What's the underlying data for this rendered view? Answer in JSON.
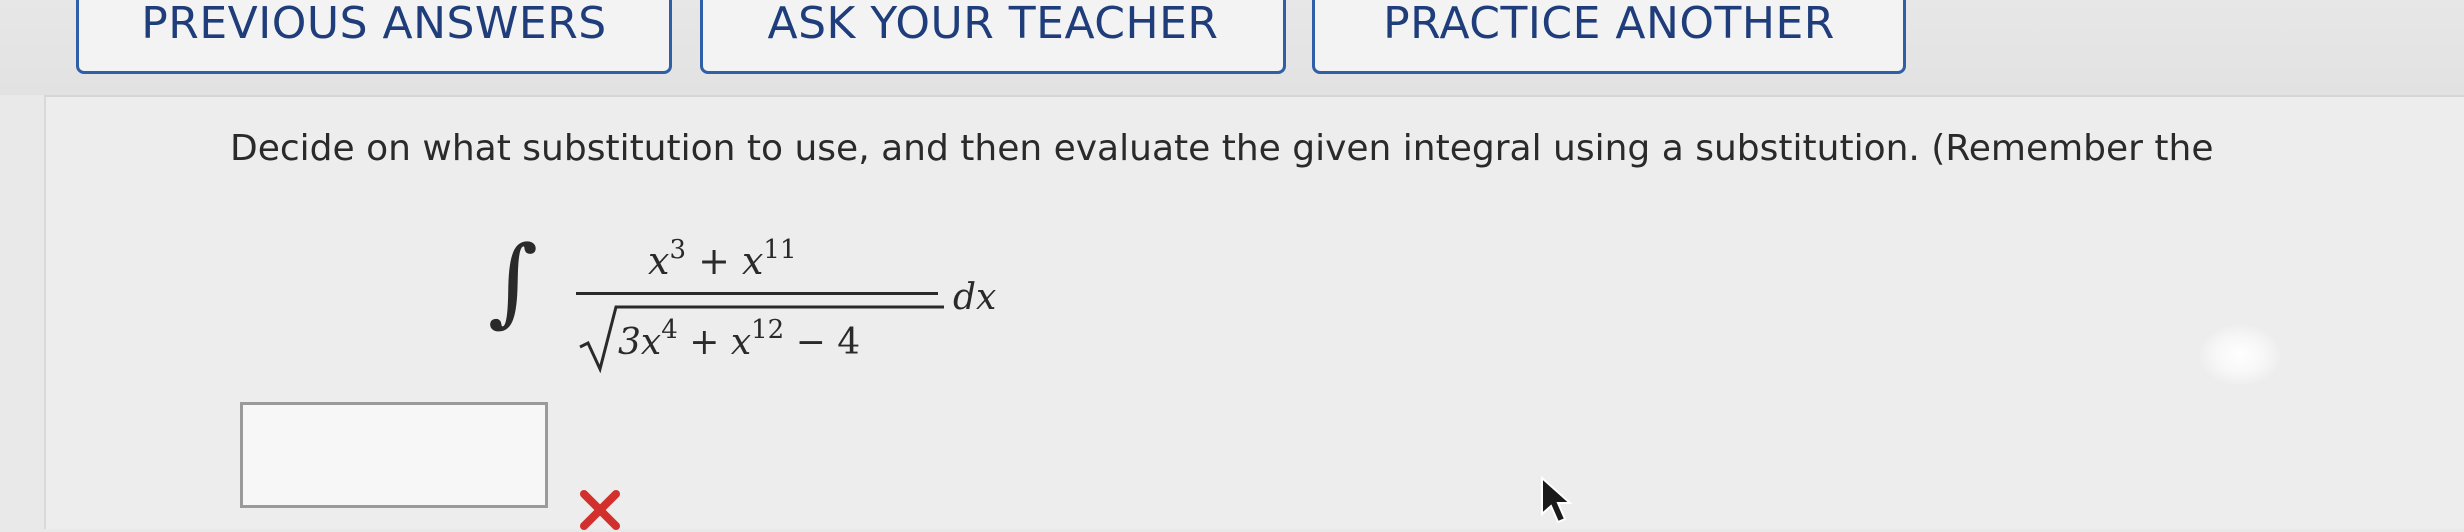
{
  "toolbar": {
    "previous_answers_label": "PREVIOUS ANSWERS",
    "ask_teacher_label": "ASK YOUR TEACHER",
    "practice_another_label": "PRACTICE ANOTHER"
  },
  "question": {
    "prompt": "Decide on what substitution to use, and then evaluate the given integral using a substitution. (Remember the"
  },
  "integral": {
    "sign": "∫",
    "numerator_term1": "x",
    "numerator_exp1": "3",
    "numerator_op": " + ",
    "numerator_term2": "x",
    "numerator_exp2": "11",
    "denom_term1": "3x",
    "denom_exp1": "4",
    "denom_op1": " + ",
    "denom_term2": "x",
    "denom_exp2": "12",
    "denom_tail": " − 4",
    "differential": "dx"
  },
  "answer": {
    "value": "",
    "status": "incorrect"
  },
  "colors": {
    "button_border": "#2f5fa6",
    "button_text": "#1f3d7a",
    "wrong_mark": "#d2302c"
  },
  "icons": {
    "wrong_mark": "x-mark-icon",
    "cursor": "mouse-pointer-icon"
  }
}
